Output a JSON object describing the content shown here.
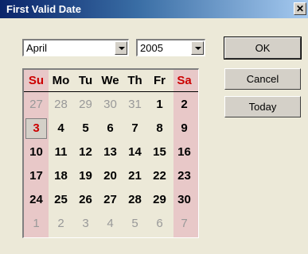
{
  "dialog": {
    "title": "First Valid Date",
    "close_glyph": "✕"
  },
  "selectors": {
    "month": "April",
    "year": "2005"
  },
  "calendar": {
    "weekdays": [
      "Su",
      "Mo",
      "Tu",
      "We",
      "Th",
      "Fr",
      "Sa"
    ],
    "weeks": [
      [
        "27",
        "28",
        "29",
        "30",
        "31",
        "1",
        "2"
      ],
      [
        "3",
        "4",
        "5",
        "6",
        "7",
        "8",
        "9"
      ],
      [
        "10",
        "11",
        "12",
        "13",
        "14",
        "15",
        "16"
      ],
      [
        "17",
        "18",
        "19",
        "20",
        "21",
        "22",
        "23"
      ],
      [
        "24",
        "25",
        "26",
        "27",
        "28",
        "29",
        "30"
      ],
      [
        "1",
        "2",
        "3",
        "4",
        "5",
        "6",
        "7"
      ]
    ],
    "selected_day": "3",
    "weekend_color": "#cc0000",
    "other_month_color": "#999999"
  },
  "buttons": {
    "ok": "OK",
    "cancel": "Cancel",
    "today": "Today"
  }
}
